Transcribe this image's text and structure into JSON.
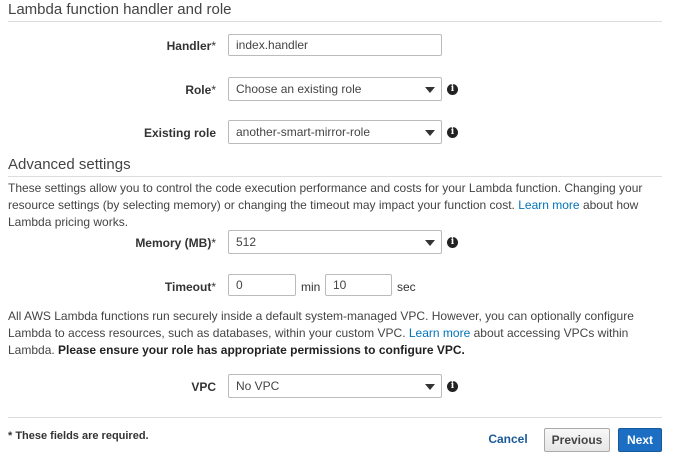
{
  "handler_section": {
    "title": "Lambda function handler and role",
    "handler": {
      "label": "Handler",
      "value": "index.handler"
    },
    "role": {
      "label": "Role",
      "selected": "Choose an existing role"
    },
    "existing_role": {
      "label": "Existing role",
      "selected": "another-smart-mirror-role"
    }
  },
  "required_mark": "*",
  "advanced": {
    "title": "Advanced settings",
    "description_pre": "These settings allow you to control the code execution performance and costs for your Lambda function. Changing your resource settings (by selecting memory) or changing the timeout may impact your function cost.",
    "description_link": "Learn more",
    "description_post": "about how Lambda pricing works.",
    "memory": {
      "label": "Memory (MB)",
      "selected": "512"
    },
    "timeout": {
      "label": "Timeout",
      "min_value": "0",
      "min_unit": "min",
      "sec_value": "10",
      "sec_unit": "sec"
    },
    "vpc_text_pre": "All AWS Lambda functions run securely inside a default system-managed VPC. However, you can optionally configure Lambda to access resources, such as databases, within your custom VPC.",
    "vpc_text_link": "Learn more",
    "vpc_text_mid": "about accessing VPCs within Lambda.",
    "vpc_text_bold": "Please ensure your role has appropriate permissions to configure VPC.",
    "vpc": {
      "label": "VPC",
      "selected": "No VPC"
    }
  },
  "footer": {
    "note": "* These fields are required.",
    "cancel": "Cancel",
    "previous": "Previous",
    "next": "Next"
  },
  "colors": {
    "link": "#0073bb",
    "primary_button": "#1b6ec2"
  },
  "icons": {
    "info": "info-circle-icon",
    "dropdown": "chevron-down-icon"
  }
}
